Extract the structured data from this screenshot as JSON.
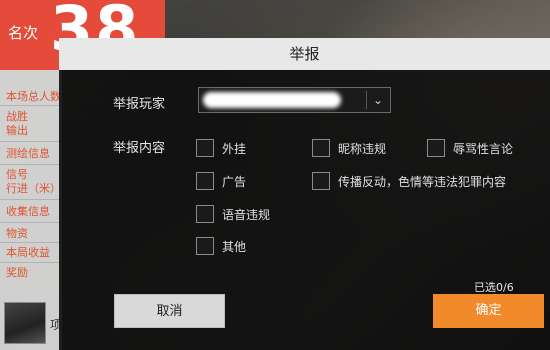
{
  "background": {
    "rank_label": "名次",
    "rank_number": "38",
    "stats": [
      "本场总人数",
      "战胜",
      "输出",
      "测绘信息",
      "信号",
      "行进（米）",
      "收集信息",
      "物资",
      "本局收益",
      "奖励"
    ],
    "player_name": "项"
  },
  "dialog": {
    "title": "举报",
    "player_label": "举报玩家",
    "player_value": "",
    "content_label": "举报内容",
    "options": [
      "外挂",
      "昵称违规",
      "辱骂性言论",
      "广告",
      "传播反动，色情等违法犯罪内容",
      "语音违规",
      "其他"
    ],
    "selected_text": "已选0/6",
    "cancel_label": "取消",
    "confirm_label": "确定"
  },
  "colors": {
    "rank_red": "#e44b3a",
    "confirm_orange": "#f08a2a",
    "stat_text": "#e0532f"
  }
}
